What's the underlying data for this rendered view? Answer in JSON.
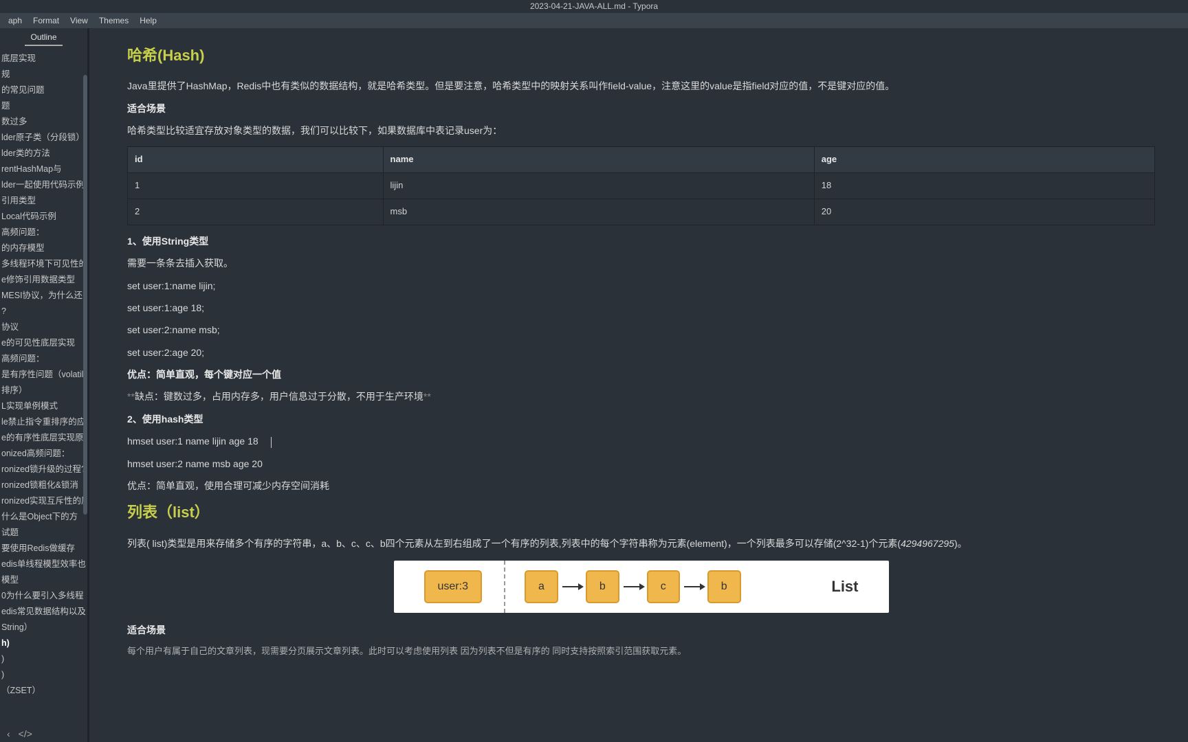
{
  "window": {
    "title": "2023-04-21-JAVA-ALL.md - Typora"
  },
  "menu": {
    "items": [
      "aph",
      "Format",
      "View",
      "Themes",
      "Help"
    ]
  },
  "sidebar": {
    "tab": "Outline",
    "items": [
      "底层实现",
      "规",
      "的常见问题",
      "题",
      "数过多",
      "lder原子类（分段锁）",
      "lder类的方法",
      "rentHashMap与",
      "lder一起使用代码示例",
      "引用类型",
      "Local代码示例",
      "高频问题：",
      "的内存模型",
      "多线程环境下可见性的方",
      "e修饰引用数据类型",
      "MESI协议，为什么还需",
      "?",
      "协议",
      "e的可见性底层实现",
      "高频问题：",
      "是有序性问题（volatile禁",
      "排序）",
      "L实现单例模式",
      "le禁止指令重排序的应",
      "e的有序性底层实现原理",
      "onized高频问题：",
      "ronized锁升级的过程?",
      "ronized锁粗化&锁消",
      "ronized实现互斥性的原",
      "什么是Object下的方",
      "试题",
      "要使用Redis做缓存",
      "edis单线程模型效率也",
      "模型",
      "0为什么要引入多线程",
      "edis常见数据结构以及",
      "String）",
      "h)",
      ")",
      ")",
      "（ZSET）"
    ]
  },
  "hash": {
    "heading": "哈希(Hash)",
    "intro": "Java里提供了HashMap，Redis中也有类似的数据结构，就是哈希类型。但是要注意，哈希类型中的映射关系叫作field-value，注意这里的value是指field对应的值，不是键对应的值。",
    "scene_title": "适合场景",
    "scene_text": "哈希类型比较适宜存放对象类型的数据，我们可以比较下，如果数据库中表记录user为：",
    "table": {
      "headers": [
        "id",
        "name",
        "age"
      ],
      "rows": [
        [
          "1",
          "lijin",
          "18"
        ],
        [
          "2",
          "msb",
          "20"
        ]
      ]
    },
    "sec1_title": "1、使用String类型",
    "sec1_text": "需要一条条去插入获取。",
    "sec1_lines": [
      "set user:1:name lijin;",
      "set user:1:age  18;",
      "set user:2:name msb;",
      "set user:2:age  20;"
    ],
    "adv1": "优点：简单直观，每个键对应一个值",
    "dis1_pre": "**",
    "dis1": "缺点：键数过多，占用内存多，用户信息过于分散，不用于生产环境",
    "dis1_post": "**",
    "sec2_title": "2、使用hash类型",
    "sec2_lines": [
      "hmset user:1 name lijin age 18",
      "hmset user:2 name msb age 20"
    ],
    "adv2": "优点：简单直观，使用合理可减少内存空间消耗"
  },
  "list": {
    "heading": "列表（list）",
    "intro_pre": "列表( list)类型是用来存储多个有序的字符串，a、b、c、c、b四个元素从左到右组成了一个有序的列表,列表中的每个字符串称为元素(element)，一个列表最多可以存储(2^32-1)个元素(",
    "intro_em": "4294967295",
    "intro_post": ")。",
    "diagram": {
      "key": "user:3",
      "nodes": [
        "a",
        "b",
        "c",
        "b"
      ],
      "label": "List"
    },
    "scene_title": "适合场景",
    "scene_text": "每个用户有属于自己的文章列表，现需要分页展示文章列表。此时可以考虑使用列表 因为列表不但是有序的 同时支持按照索引范围获取元素。"
  }
}
